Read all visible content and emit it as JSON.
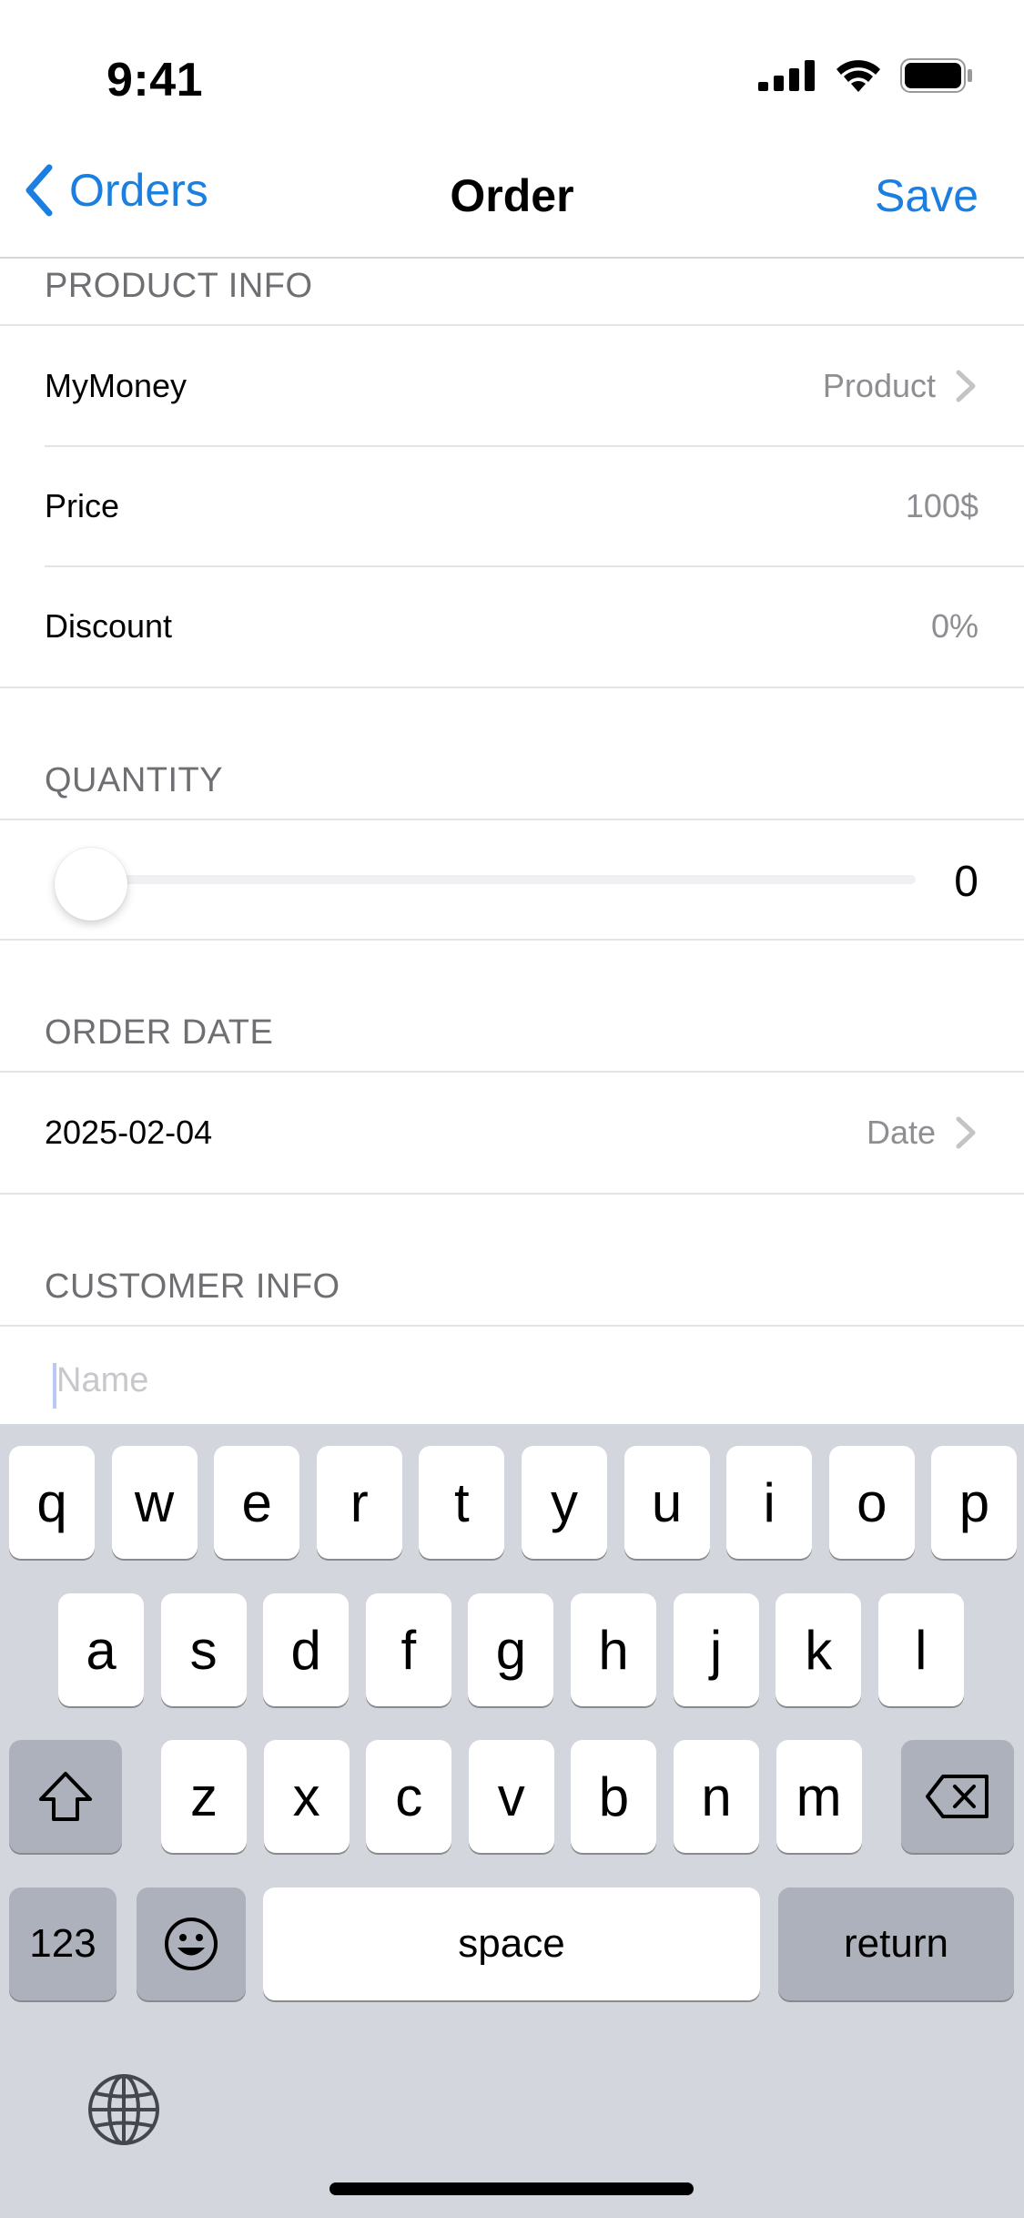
{
  "status_bar": {
    "time": "9:41"
  },
  "nav": {
    "back_label": "Orders",
    "title": "Order",
    "save_label": "Save"
  },
  "product_info": {
    "header": "PRODUCT INFO",
    "product": {
      "label": "MyMoney",
      "value": "Product"
    },
    "price": {
      "label": "Price",
      "value": "100$"
    },
    "discount": {
      "label": "Discount",
      "value": "0%"
    }
  },
  "quantity": {
    "header": "QUANTITY",
    "value": "0",
    "slider_fraction": 0
  },
  "order_date": {
    "header": "ORDER DATE",
    "label": "2025-02-04",
    "value": "Date"
  },
  "customer_info": {
    "header": "CUSTOMER INFO",
    "name_placeholder": "Name",
    "name_value": ""
  },
  "keyboard": {
    "row1": [
      "q",
      "w",
      "e",
      "r",
      "t",
      "y",
      "u",
      "i",
      "o",
      "p"
    ],
    "row2": [
      "a",
      "s",
      "d",
      "f",
      "g",
      "h",
      "j",
      "k",
      "l"
    ],
    "row3": [
      "z",
      "x",
      "c",
      "v",
      "b",
      "n",
      "m"
    ],
    "numbers_label": "123",
    "space_label": "space",
    "return_label": "return"
  },
  "colors": {
    "accent": "#1a7fe0",
    "secondary_text": "#8e8e93",
    "keyboard_bg": "#d3d6dd"
  }
}
